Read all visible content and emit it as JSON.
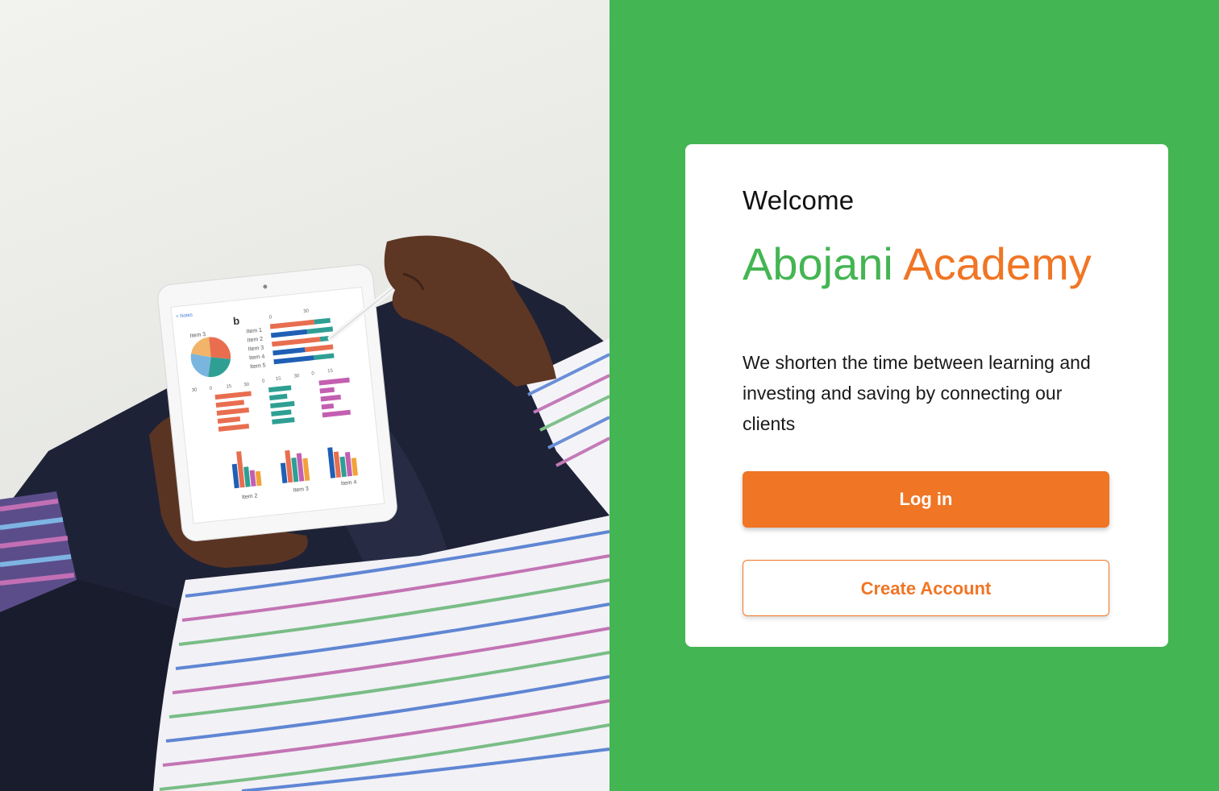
{
  "colors": {
    "brand_green": "#44b553",
    "brand_orange": "#f07524",
    "card_bg": "#ffffff"
  },
  "hero": {
    "image_description_icon": "person-with-tablet-chart-photo",
    "tablet_screen": {
      "back_link": "< Notes",
      "title": "b",
      "pie_label": "Item 3",
      "list_items": [
        "Item 1",
        "Item 2",
        "Item 3",
        "Item 4",
        "Item 5"
      ],
      "bar_axis_labels": [
        "0",
        "30"
      ],
      "small_axis_a": [
        "30",
        "0",
        "15",
        "30"
      ],
      "small_axis_b": [
        "0",
        "15",
        "30"
      ],
      "small_axis_c": [
        "0",
        "15"
      ],
      "bottom_labels": [
        "Item 2",
        "Item 3",
        "Item 4"
      ]
    }
  },
  "auth": {
    "welcome": "Welcome",
    "brand_part1": "Abojani",
    "brand_part2": "Academy",
    "tagline": "We shorten the time between learning and investing and saving by connecting our clients",
    "login_label": "Log in",
    "create_account_label": "Create Account"
  }
}
